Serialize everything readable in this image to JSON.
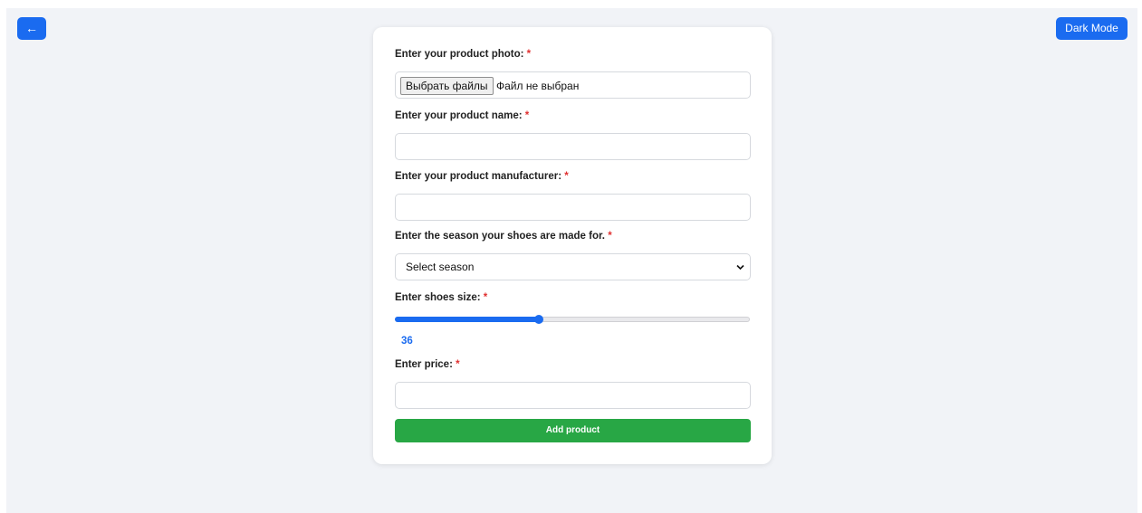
{
  "header": {
    "back_label": "←",
    "dark_mode_label": "Dark Mode"
  },
  "form": {
    "photo": {
      "label": "Enter your product photo:",
      "required_mark": "*",
      "choose_button": "Выбрать файлы",
      "no_file_text": "Файл не выбран"
    },
    "name": {
      "label": "Enter your product name:",
      "required_mark": "*",
      "value": ""
    },
    "manufacturer": {
      "label": "Enter your product manufacturer:",
      "required_mark": "*",
      "value": ""
    },
    "season": {
      "label": "Enter the season your shoes are made for.",
      "required_mark": "*",
      "selected": "Select season"
    },
    "size": {
      "label": "Enter shoes size:",
      "required_mark": "*",
      "value": "36",
      "fill_fraction": 0.405
    },
    "price": {
      "label": "Enter price:",
      "required_mark": "*",
      "value": ""
    },
    "submit_label": "Add product"
  },
  "colors": {
    "primary": "#1a6bf0",
    "success": "#28a745",
    "required": "#e03131",
    "background": "#f1f3f7"
  }
}
